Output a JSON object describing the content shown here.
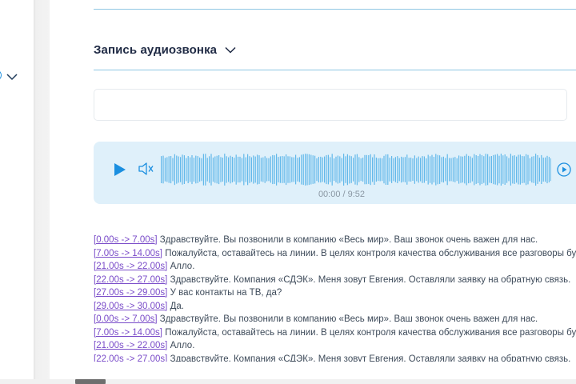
{
  "section": {
    "title": "Запись аудиозвонка"
  },
  "player": {
    "time": "00:00 / 9:52",
    "accent": "#1b8fe0",
    "wave_color": "#62b8ea",
    "icons": {
      "play": "play-icon",
      "volume": "volume-icon",
      "speed": "playback-speed-icon"
    }
  },
  "transcript": [
    {
      "ts": "[0.00s -> 7.00s]",
      "text": " Здравствуйте. Вы позвонили в компанию «Весь мир». Ваш звонок очень важен для нас."
    },
    {
      "ts": "[7.00s -> 14.00s]",
      "text": " Пожалуйста, оставайтесь на линии. В целях контроля качества обслуживания все разговоры будут записаны."
    },
    {
      "ts": "[21.00s -> 22.00s]",
      "text": " Алло."
    },
    {
      "ts": "[22.00s -> 27.00s]",
      "text": " Здравствуйте. Компания «СДЭК». Меня зовут Евгения. Оставляли заявку на обратную связь."
    },
    {
      "ts": "[27.00s -> 29.00s]",
      "text": " У вас контакты на ТВ, да?"
    },
    {
      "ts": "[29.00s -> 30.00s]",
      "text": " Да."
    },
    {
      "ts": "[0.00s -> 7.00s]",
      "text": " Здравствуйте. Вы позвонили в компанию «Весь мир». Ваш звонок очень важен для нас."
    },
    {
      "ts": "[7.00s -> 14.00s]",
      "text": " Пожалуйста, оставайтесь на линии. В целях контроля качества обслуживания все разговоры будут записаны."
    },
    {
      "ts": "[21.00s -> 22.00s]",
      "text": " Алло."
    },
    {
      "ts": "[22.00s -> 27.00s]",
      "text": " Здравствуйте. Компания «СДЭК». Меня зовут Евгения. Оставляли заявку на обратную связь."
    }
  ]
}
